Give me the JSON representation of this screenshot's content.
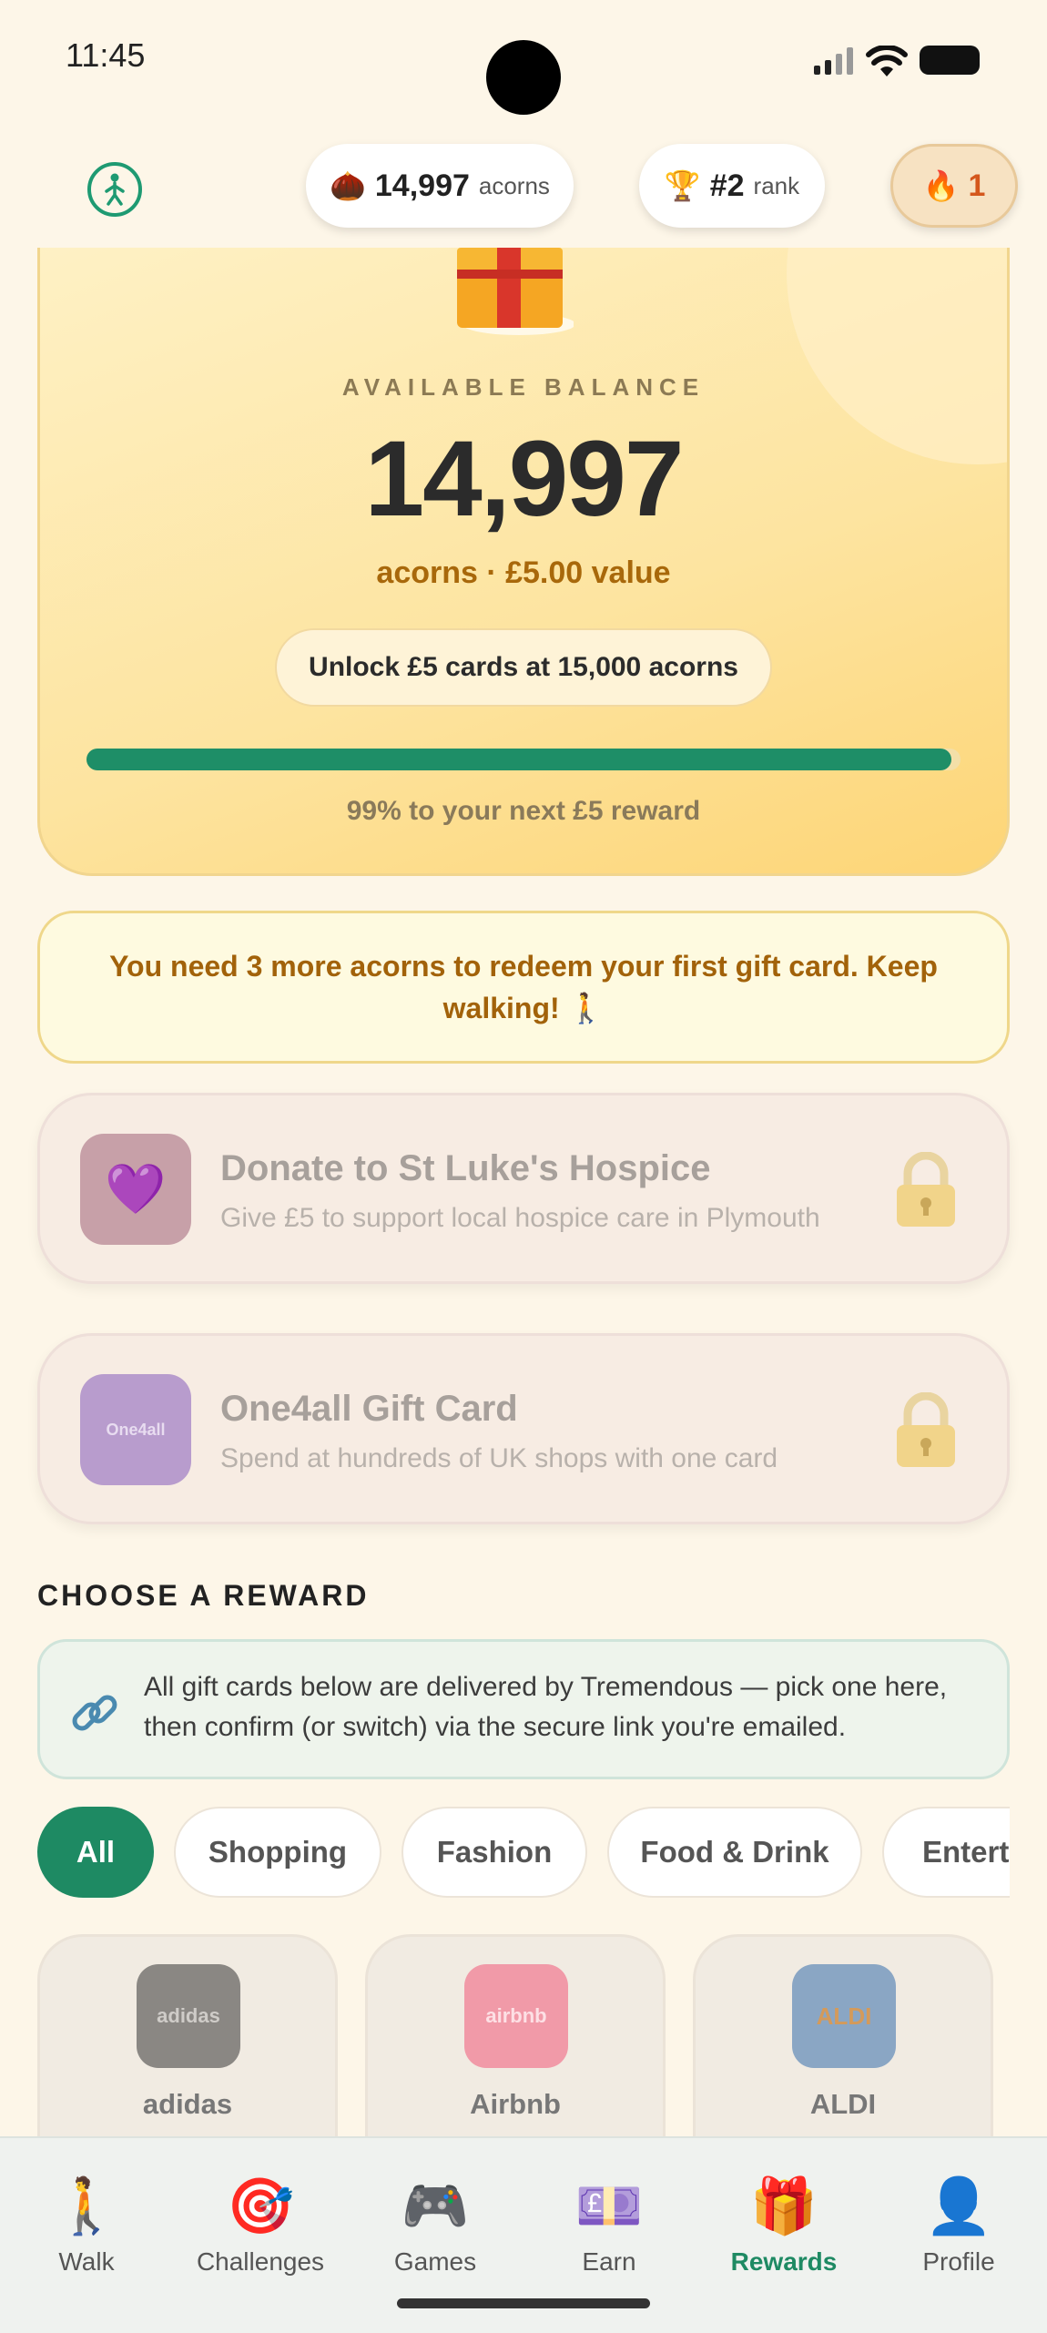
{
  "status_bar": {
    "time": "11:45"
  },
  "header": {
    "acorns_value": "14,997",
    "acorns_unit": "acorns",
    "rank_value": "#2",
    "rank_unit": "rank",
    "streak_value": "1",
    "icons": {
      "logo": "walker-icon",
      "acorn": "acorn-icon",
      "trophy": "trophy-icon",
      "flame": "flame-icon"
    }
  },
  "balance": {
    "label": "AVAILABLE BALANCE",
    "value": "14,997",
    "subtitle": "acorns · £5.00 value",
    "unlock_label": "Unlock £5 cards at 15,000 acorns",
    "progress_fraction": 0.99,
    "progress_text": "99% to your next £5 reward"
  },
  "notice": {
    "text": "You need 3 more acorns to redeem your first gift card. Keep walking! 🚶"
  },
  "locked_rewards": [
    {
      "title": "Donate to St Luke's Hospice",
      "description": "Give £5 to support local hospice care in Plymouth",
      "icon": "heart-icon",
      "icon_text": "💜",
      "color": "#c7a0a8"
    },
    {
      "title": "One4all Gift Card",
      "description": "Spend at hundreds of UK shops with one card",
      "icon": "one4all-logo",
      "icon_text": "One4all",
      "color": "#b89ccd"
    }
  ],
  "choose": {
    "title": "CHOOSE A REWARD",
    "info": "All gift cards below are delivered by Tremendous — pick one here, then confirm (or switch) via the secure link you're emailed."
  },
  "categories": [
    "All",
    "Shopping",
    "Fashion",
    "Food & Drink",
    "Entertainment"
  ],
  "active_category": "All",
  "brands": [
    {
      "name": "adidas",
      "logo_text": "adidas",
      "color": "#8a8783",
      "text_color": "#cfccc8"
    },
    {
      "name": "Airbnb",
      "logo_text": "airbnb",
      "color": "#f19aa8",
      "text_color": "#fde0e5"
    },
    {
      "name": "ALDI",
      "logo_text": "ALDI",
      "color": "#8aa6c4",
      "text_color": "#d49a5a"
    }
  ],
  "nav": [
    {
      "label": "Walk",
      "icon": "🚶"
    },
    {
      "label": "Challenges",
      "icon": "🎯"
    },
    {
      "label": "Games",
      "icon": "🎮"
    },
    {
      "label": "Earn",
      "icon": "💷"
    },
    {
      "label": "Rewards",
      "icon": "🎁"
    },
    {
      "label": "Profile",
      "icon": "👤"
    }
  ],
  "active_nav": "Rewards"
}
